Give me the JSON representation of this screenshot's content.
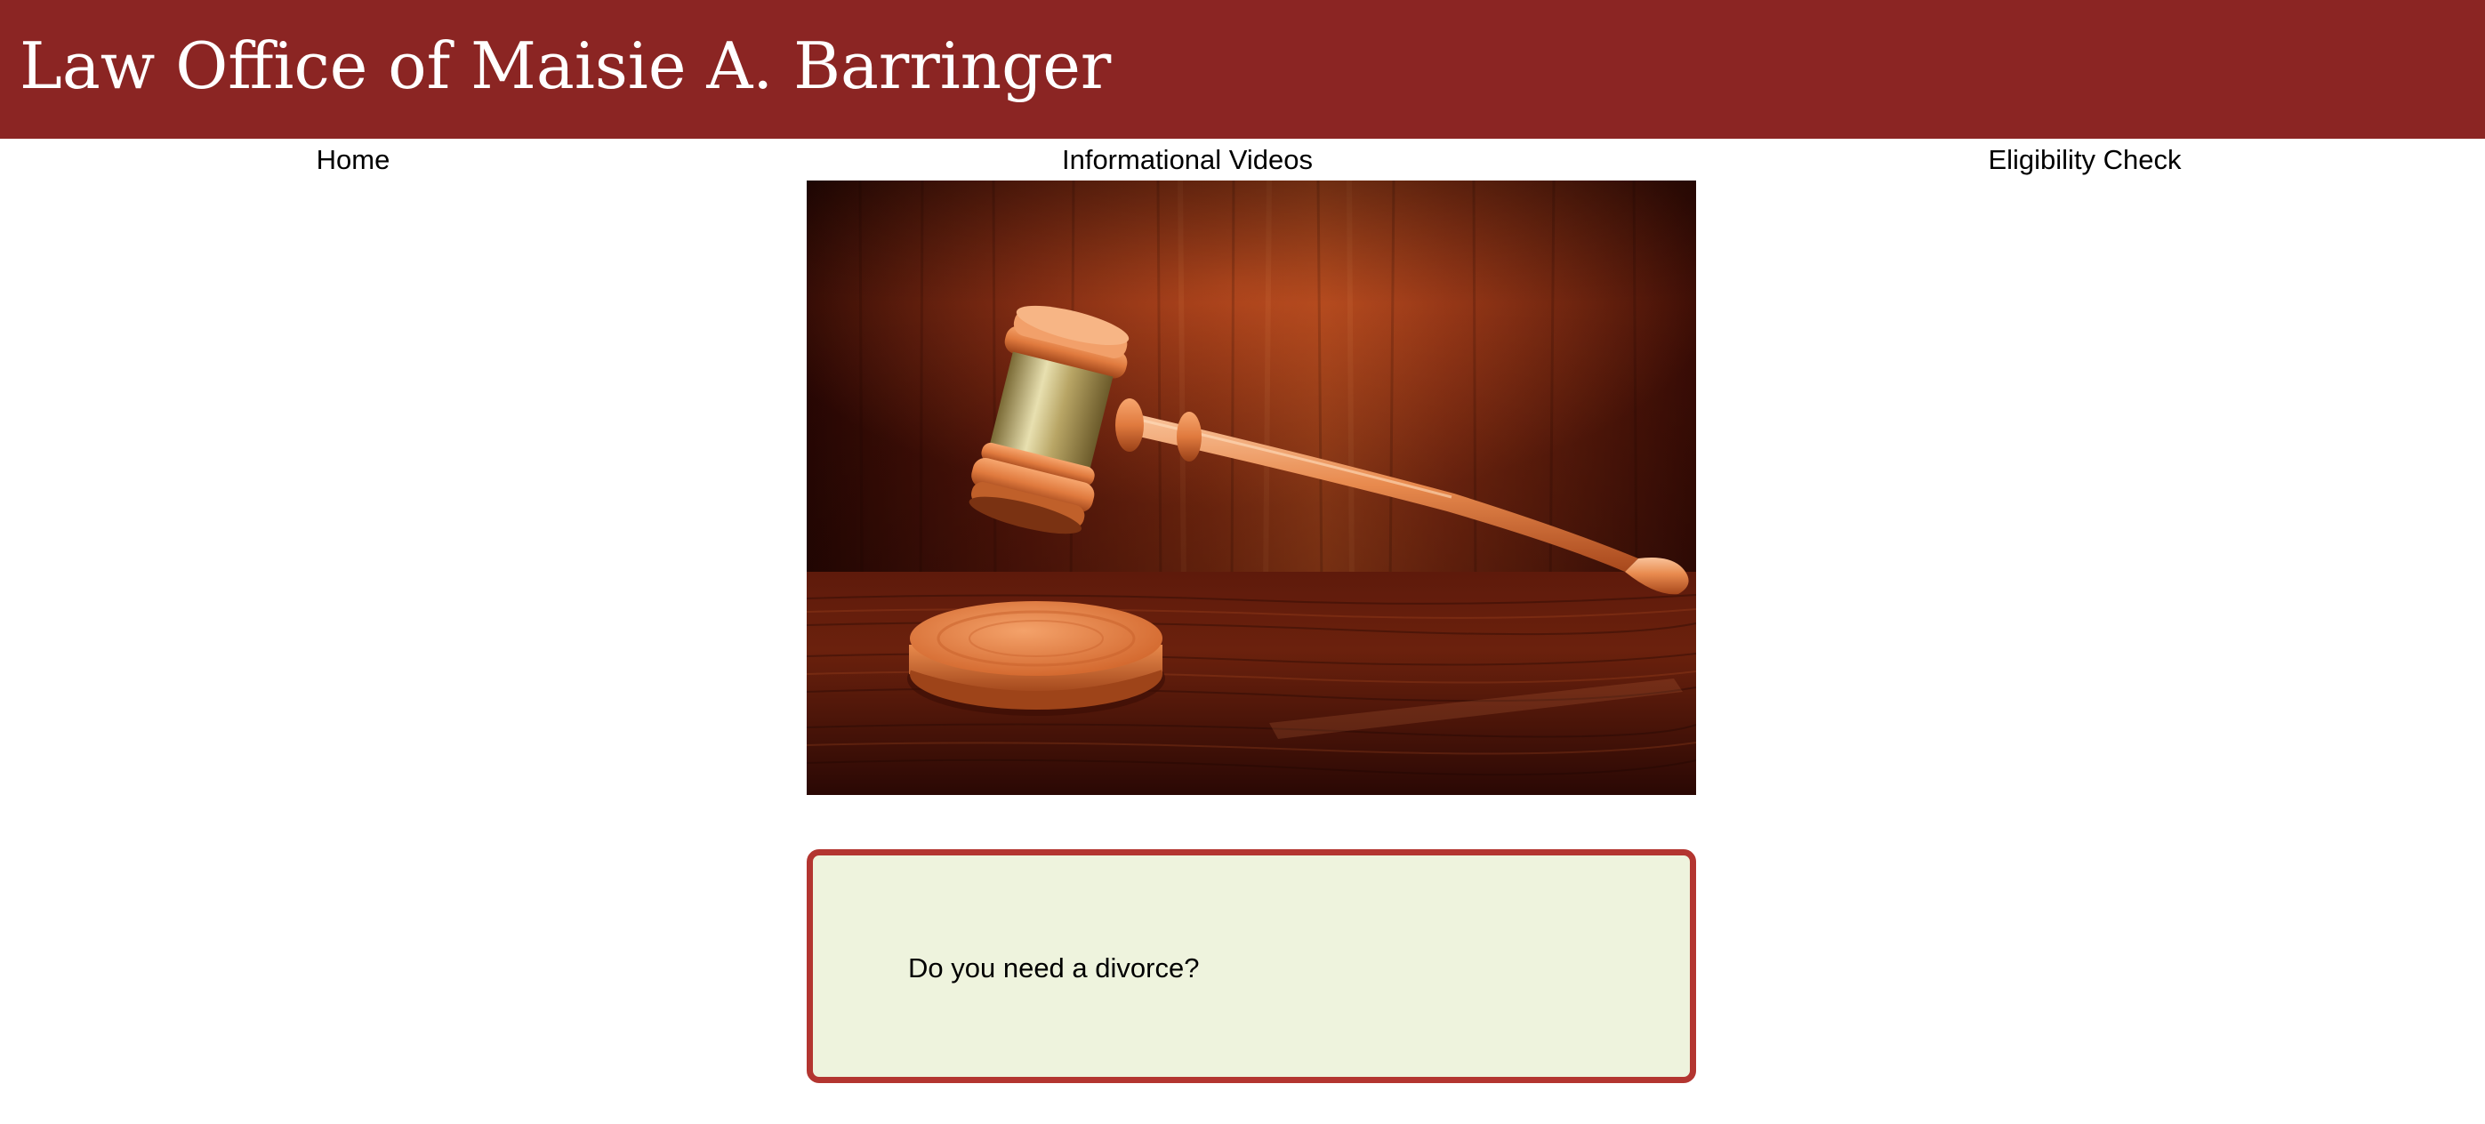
{
  "header": {
    "title": "Law Office of Maisie A. Barringer",
    "background_color": "#8b2523"
  },
  "nav": {
    "items": [
      {
        "label": "Home"
      },
      {
        "label": "Informational Videos"
      },
      {
        "label": "Eligibility Check"
      }
    ]
  },
  "hero": {
    "image_subject": "judge-gavel-on-sound-block"
  },
  "callout": {
    "text": "Do you need a divorce?",
    "border_color": "#b33530",
    "background_color": "#eef3dd"
  }
}
